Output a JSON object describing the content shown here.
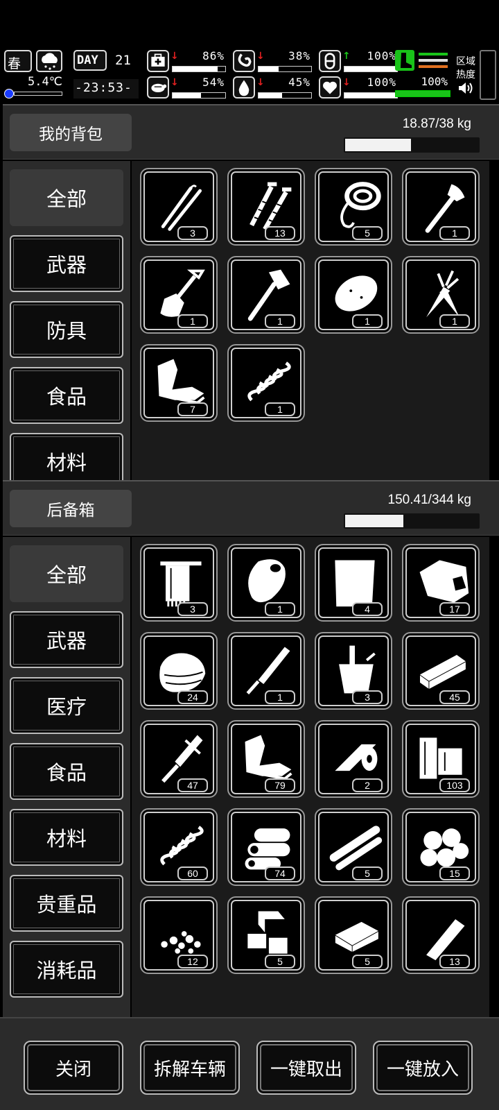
{
  "status": {
    "season": "春",
    "temperature": "5.4℃",
    "day_label": "DAY",
    "day_number": "21",
    "clock": "-23:53-",
    "stats": [
      {
        "key": "health",
        "icon": "medkit-icon",
        "trend": "down",
        "value": "86%",
        "level": 0.86
      },
      {
        "key": "hunger",
        "icon": "stomach-icon",
        "trend": "down",
        "value": "38%",
        "level": 0.38
      },
      {
        "key": "armor",
        "icon": "capsule-icon",
        "trend": "up",
        "value": "100%",
        "level": 1.0
      },
      {
        "key": "fatigue",
        "icon": "turtle-icon",
        "trend": "down",
        "value": "54%",
        "level": 0.54
      },
      {
        "key": "thirst",
        "icon": "water-drop-icon",
        "trend": "down",
        "value": "45%",
        "level": 0.45
      },
      {
        "key": "mood",
        "icon": "heart-icon",
        "trend": "down",
        "value": "100%",
        "level": 1.0
      }
    ],
    "stamina_value": "100%",
    "area_heat_label_1": "区域",
    "area_heat_label_2": "热度"
  },
  "backpack": {
    "title": "我的背包",
    "weight": "18.87/38 kg",
    "weight_fraction": 0.497,
    "categories": [
      {
        "label": "全部",
        "active": true
      },
      {
        "label": "武器",
        "active": false
      },
      {
        "label": "防具",
        "active": false
      },
      {
        "label": "食品",
        "active": false
      },
      {
        "label": "材料",
        "active": false
      }
    ],
    "items": [
      {
        "name": "lockpicks",
        "icon": "lockpick-icon",
        "count": "3"
      },
      {
        "name": "screws",
        "icon": "screws-icon",
        "count": "13"
      },
      {
        "name": "rope",
        "icon": "rope-icon",
        "count": "5"
      },
      {
        "name": "axe",
        "icon": "axe-icon",
        "count": "1"
      },
      {
        "name": "shovel",
        "icon": "shovel-icon",
        "count": "1"
      },
      {
        "name": "hatchet",
        "icon": "hatchet-icon",
        "count": "1"
      },
      {
        "name": "potato",
        "icon": "potato-icon",
        "count": "1"
      },
      {
        "name": "carrot",
        "icon": "carrot-icon",
        "count": "1"
      },
      {
        "name": "scrap-metal",
        "icon": "scrap-metal-icon",
        "count": "7"
      },
      {
        "name": "spring",
        "icon": "spring-icon",
        "count": "1"
      }
    ]
  },
  "trunk": {
    "title": "后备箱",
    "weight": "150.41/344 kg",
    "weight_fraction": 0.437,
    "categories": [
      {
        "label": "全部",
        "active": true
      },
      {
        "label": "武器",
        "active": false
      },
      {
        "label": "医疗",
        "active": false
      },
      {
        "label": "食品",
        "active": false
      },
      {
        "label": "材料",
        "active": false
      },
      {
        "label": "贵重品",
        "active": false
      },
      {
        "label": "消耗品",
        "active": false
      }
    ],
    "items": [
      {
        "name": "towel",
        "icon": "towel-icon",
        "count": "3"
      },
      {
        "name": "raw-meat",
        "icon": "meat-icon",
        "count": "1"
      },
      {
        "name": "cloth",
        "icon": "cloth-icon",
        "count": "4"
      },
      {
        "name": "stuffed-bag",
        "icon": "bag-icon",
        "count": "17"
      },
      {
        "name": "rags",
        "icon": "rags-icon",
        "count": "24"
      },
      {
        "name": "machete",
        "icon": "machete-icon",
        "count": "1"
      },
      {
        "name": "bucket",
        "icon": "bucket-icon",
        "count": "3"
      },
      {
        "name": "wood-plank",
        "icon": "plank-icon",
        "count": "45"
      },
      {
        "name": "rasp-tool",
        "icon": "rasp-icon",
        "count": "47"
      },
      {
        "name": "scrap-metal",
        "icon": "scrap-metal-icon",
        "count": "79"
      },
      {
        "name": "tape-roll",
        "icon": "tape-icon",
        "count": "2"
      },
      {
        "name": "firewood",
        "icon": "firewood-icon",
        "count": "103"
      },
      {
        "name": "spring",
        "icon": "spring-icon",
        "count": "60"
      },
      {
        "name": "logs",
        "icon": "logs-icon",
        "count": "74"
      },
      {
        "name": "pipes",
        "icon": "pipes-icon",
        "count": "5"
      },
      {
        "name": "stones",
        "icon": "stones-icon",
        "count": "15"
      },
      {
        "name": "gravel",
        "icon": "gravel-icon",
        "count": "12"
      },
      {
        "name": "bricks",
        "icon": "bricks-icon",
        "count": "5"
      },
      {
        "name": "sponge",
        "icon": "sponge-icon",
        "count": "5"
      },
      {
        "name": "tube",
        "icon": "tube-icon",
        "count": "13"
      }
    ]
  },
  "actions": {
    "close": "关闭",
    "dismantle": "拆解车辆",
    "take_all": "一键取出",
    "put_all": "一键放入"
  },
  "colors": {
    "panel": "#2b2b2b",
    "grid_bg": "#1b1b1b",
    "stamina_green": "#19c319",
    "trend_up": "#19c319",
    "trend_down": "#e02020",
    "temp_dot": "#1a3cff"
  }
}
